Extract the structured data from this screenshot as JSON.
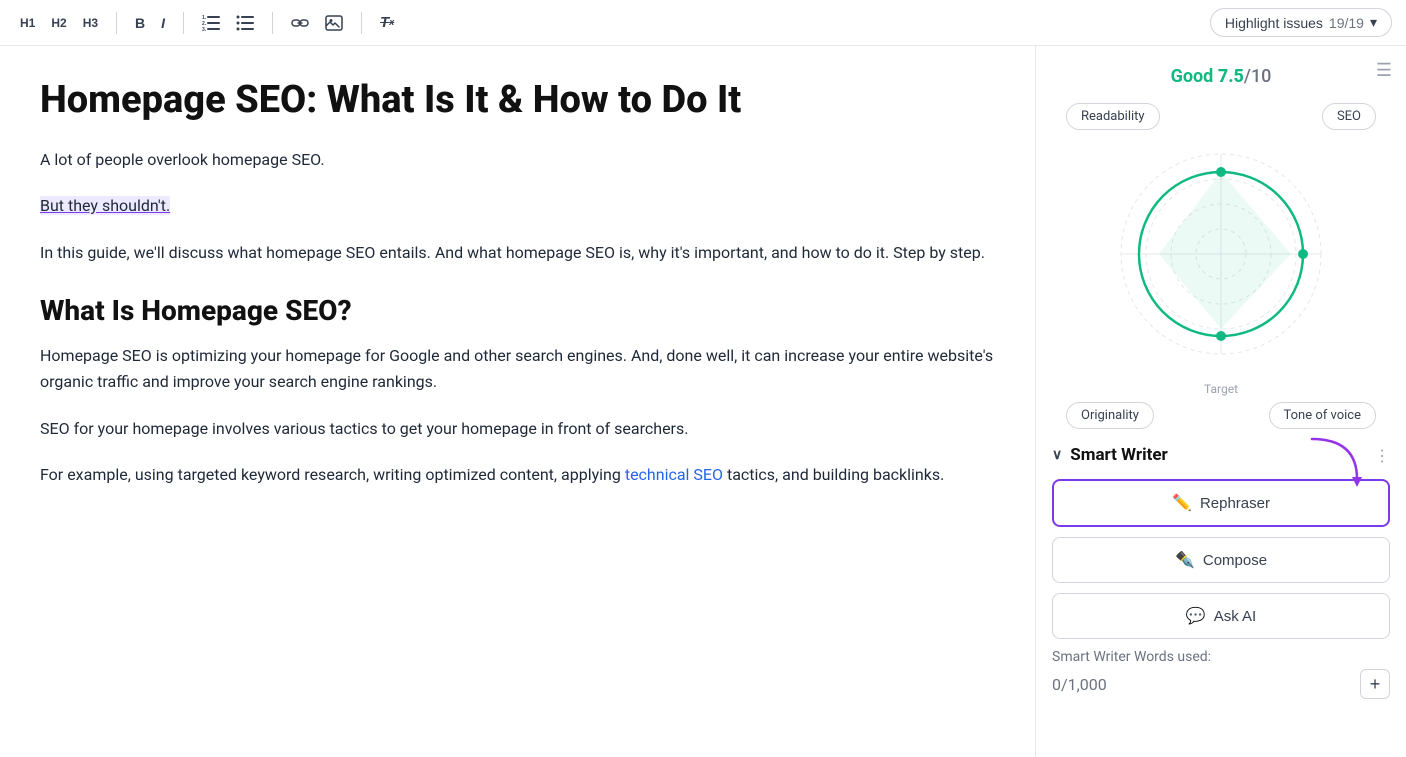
{
  "toolbar": {
    "h1_label": "H1",
    "h2_label": "H2",
    "h3_label": "H3",
    "bold_label": "B",
    "italic_label": "I",
    "highlight_label": "Highlight issues",
    "highlight_count": "19/19"
  },
  "editor": {
    "title": "Homepage SEO: What Is It & How to Do It",
    "paragraph1": "A lot of people overlook homepage SEO.",
    "highlighted_sentence": "But they shouldn't.",
    "paragraph2": "In this guide, we'll discuss what homepage SEO entails. And what homepage SEO is, why it's important, and how to do it. Step by step.",
    "heading2": "What Is Homepage SEO?",
    "paragraph3": "Homepage SEO is optimizing your homepage for Google and other search engines. And, done well, it can increase your entire website's organic traffic and improve your search engine rankings.",
    "paragraph4": "SEO for your homepage involves various tactics to get your homepage in front of searchers.",
    "paragraph5_before_link": "For example, using targeted keyword research, writing optimized content, applying ",
    "paragraph5_link": "technical SEO",
    "paragraph5_after_link": " tactics, and building backlinks."
  },
  "panel": {
    "score_label": "Good",
    "score_value": "7.5",
    "score_denom": "/10",
    "radar_labels": {
      "top_left": "Readability",
      "top_right": "SEO",
      "bottom_left": "Originality",
      "bottom_right": "Tone of voice"
    },
    "target_label": "Target",
    "smart_writer_title": "Smart Writer",
    "rephraser_label": "Rephraser",
    "compose_label": "Compose",
    "ask_ai_label": "Ask AI",
    "words_used_label": "Smart Writer Words used:",
    "words_count": "0",
    "words_limit": "/1,000"
  }
}
